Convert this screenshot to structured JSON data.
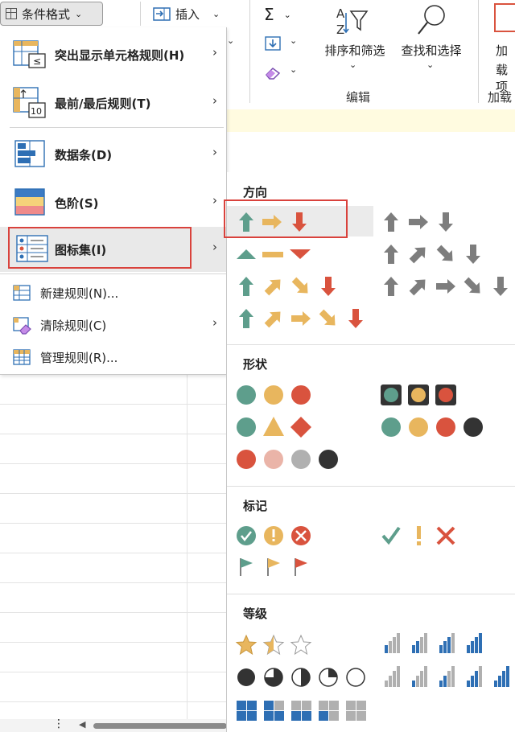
{
  "ribbon": {
    "cond_format_label": "条件格式",
    "insert_label": "插入",
    "sort_filter_label": "排序和筛选",
    "find_select_label": "查找和选择",
    "edit_group_label": "编辑",
    "addin_label_top": "加",
    "addin_label_bottom": "载项",
    "addin_group_label": "加载"
  },
  "menu": {
    "items": [
      {
        "label": "突出显示单元格规则(H)",
        "icon": "highlight-cells-icon"
      },
      {
        "label": "最前/最后规则(T)",
        "icon": "top-bottom-icon"
      },
      {
        "label": "数据条(D)",
        "icon": "data-bars-icon"
      },
      {
        "label": "色阶(S)",
        "icon": "color-scales-icon"
      },
      {
        "label": "图标集(I)",
        "icon": "icon-sets-icon"
      },
      {
        "label": "新建规则(N)...",
        "icon": "new-rule-icon"
      },
      {
        "label": "清除规则(C)",
        "icon": "clear-rules-icon"
      },
      {
        "label": "管理规则(R)...",
        "icon": "manage-rules-icon"
      }
    ]
  },
  "submenu": {
    "sections": [
      {
        "title": "方向"
      },
      {
        "title": "形状"
      },
      {
        "title": "标记"
      },
      {
        "title": "等级"
      }
    ]
  },
  "colors": {
    "green": "#5e9e8c",
    "yellow": "#e8b65e",
    "red": "#d9533e",
    "gray": "#7d7d7d",
    "highlight_border": "#d9423c",
    "blue": "#2e6fb4"
  }
}
